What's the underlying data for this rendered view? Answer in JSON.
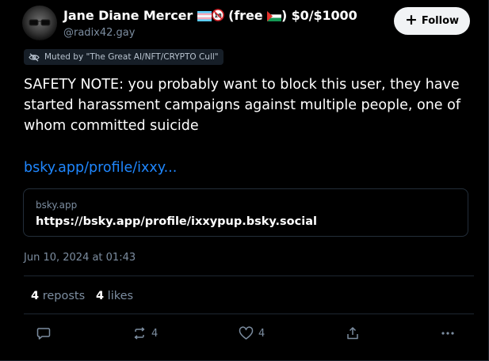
{
  "author": {
    "display_name_prefix": "Jane Diane Mercer",
    "badge_18": "18",
    "display_name_middle": "(free",
    "display_name_suffix": ") $0/$1000",
    "handle": "@radix42.gay"
  },
  "follow_button": {
    "label": "Follow"
  },
  "muted_banner": {
    "text": "Muted by \"The Great AI/NFT/CRYPTO Cull\""
  },
  "post": {
    "text": "SAFETY NOTE: you probably want to block this user, they have started harassment campaigns against multiple people, one of whom committed suicide",
    "link_text": "bsky.app/profile/ixxy..."
  },
  "embed": {
    "domain": "bsky.app",
    "url": "https://bsky.app/profile/ixxypup.bsky.social"
  },
  "timestamp": "Jun 10, 2024 at 01:43",
  "stats": {
    "reposts_count": "4",
    "reposts_label": "reposts",
    "likes_count": "4",
    "likes_label": "likes"
  },
  "actions": {
    "reply_count": "",
    "repost_count": "4",
    "like_count": "4"
  },
  "icons": {
    "flag_trans": "trans-flag-icon",
    "no_under_18": "no-under-18-icon",
    "flag_palestine": "palestine-flag-icon",
    "muted": "eye-slash-icon",
    "reply": "speech-bubble-icon",
    "repost": "repost-arrows-icon",
    "like": "heart-icon",
    "share": "share-icon",
    "more": "ellipsis-icon"
  },
  "colors": {
    "background": "#000000",
    "link": "#1f87ff",
    "muted_text": "#7c8da0",
    "follow_bg": "#f1f3f5"
  }
}
